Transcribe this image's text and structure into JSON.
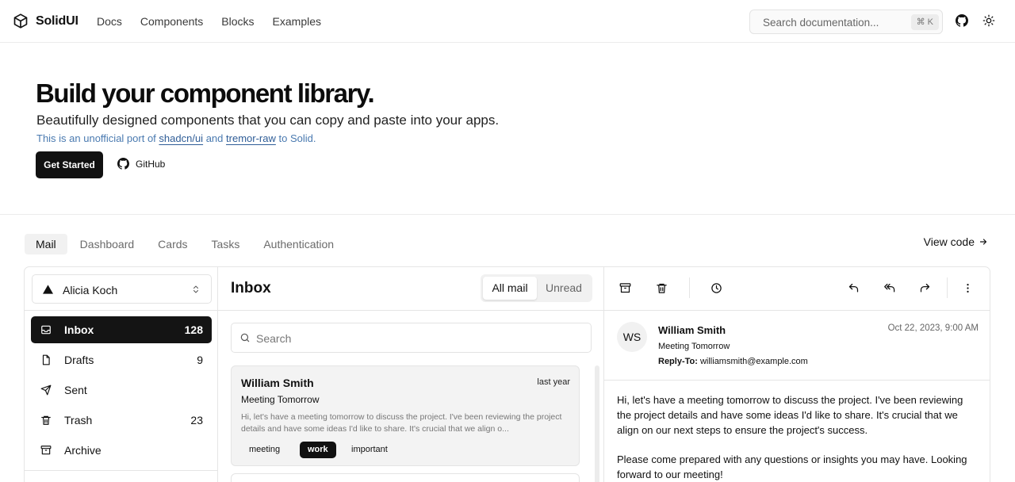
{
  "header": {
    "brand": "SolidUI",
    "nav": [
      "Docs",
      "Components",
      "Blocks",
      "Examples"
    ],
    "search_placeholder": "Search documentation...",
    "search_shortcut": "⌘ K"
  },
  "hero": {
    "title": "Build your component library.",
    "subtitle": "Beautifully designed components that you can copy and paste into your apps.",
    "note_prefix": "This is an unofficial port of",
    "note_link1": "shadcn/ui",
    "note_and": "and",
    "note_link2": "tremor-raw",
    "note_suffix": "to Solid.",
    "primary_button": "Get Started",
    "github_button": "GitHub"
  },
  "example_tabs": [
    "Mail",
    "Dashboard",
    "Cards",
    "Tasks",
    "Authentication"
  ],
  "view_code": "View code",
  "mail": {
    "account": "Alicia Koch",
    "folders": [
      {
        "label": "Inbox",
        "count": "128",
        "icon": "inbox-icon"
      },
      {
        "label": "Drafts",
        "count": "9",
        "icon": "file-icon"
      },
      {
        "label": "Sent",
        "count": "",
        "icon": "send-icon"
      },
      {
        "label": "Trash",
        "count": "23",
        "icon": "trash-icon"
      },
      {
        "label": "Archive",
        "count": "",
        "icon": "archive-icon"
      }
    ],
    "list_title": "Inbox",
    "filter_all": "All mail",
    "filter_unread": "Unread",
    "search_placeholder": "Search",
    "messages": [
      {
        "from": "William Smith",
        "when": "last year",
        "subject": "Meeting Tomorrow",
        "preview": "Hi, let's have a meeting tomorrow to discuss the project. I've been reviewing the project details and have some ideas I'd like to share. It's crucial that we align o...",
        "tags": [
          "meeting",
          "work",
          "important"
        ]
      }
    ],
    "detail": {
      "initials": "WS",
      "sender": "William Smith",
      "subject": "Meeting Tomorrow",
      "reply_to_label": "Reply-To:",
      "reply_to": "williamsmith@example.com",
      "date": "Oct 22, 2023, 9:00 AM",
      "body": [
        "Hi, let's have a meeting tomorrow to discuss the project. I've been reviewing the project details and have some ideas I'd like to share. It's crucial that we align on our next steps to ensure the project's success.",
        "Please come prepared with any questions or insights you may have. Looking forward to our meeting!"
      ]
    }
  }
}
